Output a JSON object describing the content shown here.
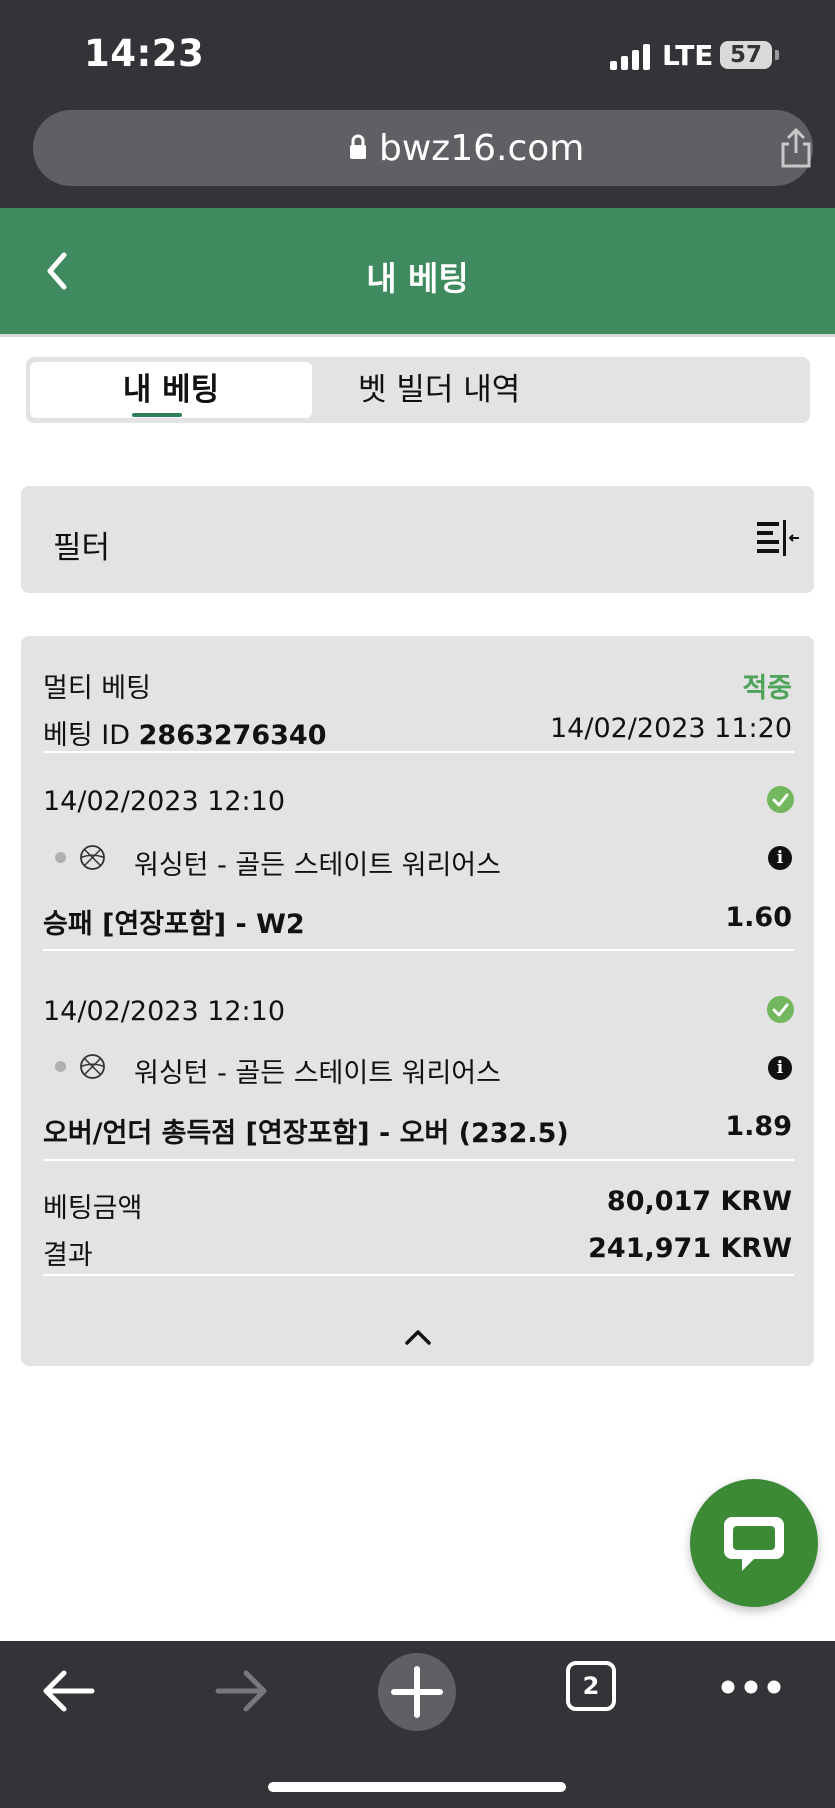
{
  "status_bar": {
    "time": "14:23",
    "network": "LTE",
    "battery": "57"
  },
  "browser": {
    "url": "bwz16.com"
  },
  "header": {
    "title": "내 베팅"
  },
  "tabs": [
    {
      "label": "내 베팅",
      "active": true
    },
    {
      "label": "벳 빌더 내역",
      "active": false
    }
  ],
  "filter": {
    "label": "필터"
  },
  "bet": {
    "type": "멀티 베팅",
    "status": "적중",
    "id_label": "베팅 ID",
    "id": "2863276340",
    "placed_at": "14/02/2023 11:20",
    "selections": [
      {
        "datetime": "14/02/2023 12:10",
        "match": "워싱턴 - 골든 스테이트 워리어스",
        "market": "승패 [연장포함] - W2",
        "odds": "1.60",
        "sport_icon": "basketball-icon",
        "won": true
      },
      {
        "datetime": "14/02/2023 12:10",
        "match": "워싱턴 - 골든 스테이트 워리어스",
        "market": "오버/언더 총득점 [연장포함] - 오버 (232.5)",
        "odds": "1.89",
        "sport_icon": "basketball-icon",
        "won": true
      }
    ],
    "stake_label": "베팅금액",
    "stake": "80,017 KRW",
    "result_label": "결과",
    "result": "241,971 KRW"
  },
  "bottom_toolbar": {
    "tab_count": "2"
  },
  "colors": {
    "header_green": "#3f8a5e",
    "win_green": "#4fa35a",
    "chat_green": "#3c8a35",
    "chrome_dark": "#333437"
  }
}
